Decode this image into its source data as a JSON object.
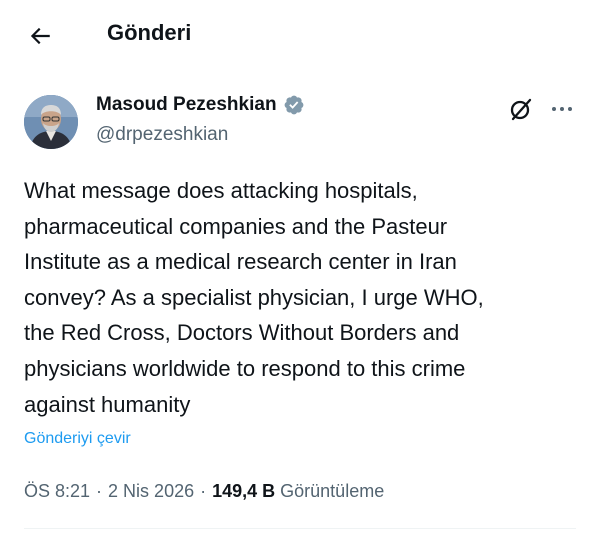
{
  "header": {
    "title": "Gönderi",
    "back_icon": "arrow-left-icon"
  },
  "author": {
    "name": "Masoud Pezeshkian",
    "handle": "@drpezeshkian",
    "verified": true,
    "verified_icon": "verified-badge-icon",
    "verified_color": "#829aab"
  },
  "actions": {
    "grok_icon": "grok-icon",
    "more_icon": "more-horizontal-icon"
  },
  "post": {
    "text": "What message does attacking hospitals,\npharmaceutical companies and the Pasteur\nInstitute as a medical research center in Iran\nconvey? As a specialist physician, I urge WHO,\nthe Red Cross, Doctors Without Borders and\nphysicians worldwide to respond to this crime\nagainst humanity",
    "translate_label": "Gönderiyi çevir",
    "time": "ÖS 8:21",
    "separator": "·",
    "date": "2 Nis 2026",
    "views_count": "149,4 B",
    "views_label": "Görüntüleme"
  },
  "colors": {
    "text": "#0f1419",
    "secondary": "#536471",
    "link": "#1d9bf0",
    "divider": "#eff3f4"
  }
}
